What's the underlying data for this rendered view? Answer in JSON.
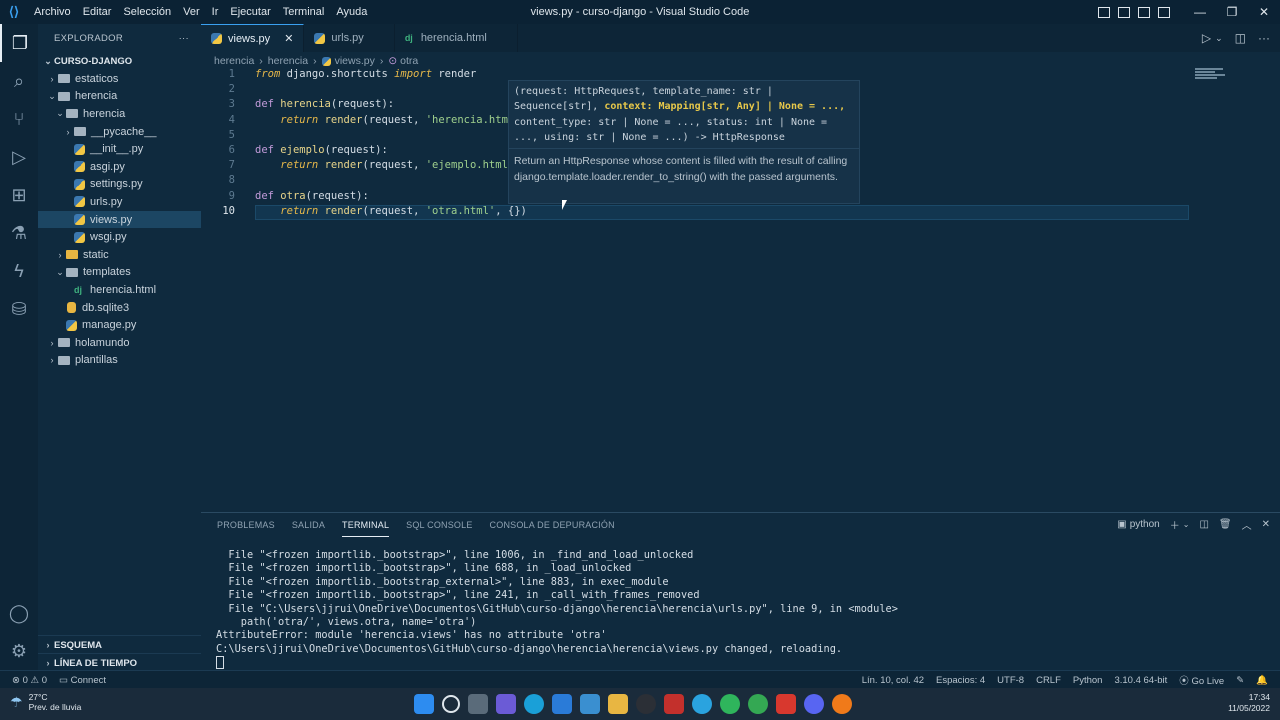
{
  "window": {
    "title": "views.py - curso-django - Visual Studio Code"
  },
  "menu": [
    "Archivo",
    "Editar",
    "Selección",
    "Ver",
    "Ir",
    "Ejecutar",
    "Terminal",
    "Ayuda"
  ],
  "sidebar": {
    "header": "EXPLORADOR",
    "root": "CURSO-DJANGO",
    "tree": [
      {
        "label": "estaticos",
        "type": "folder",
        "depth": 1,
        "expanded": false
      },
      {
        "label": "herencia",
        "type": "folder",
        "depth": 1,
        "expanded": true
      },
      {
        "label": "herencia",
        "type": "folder",
        "depth": 2,
        "expanded": true
      },
      {
        "label": "__pycache__",
        "type": "folder",
        "depth": 3,
        "expanded": false
      },
      {
        "label": "__init__.py",
        "type": "py",
        "depth": 3
      },
      {
        "label": "asgi.py",
        "type": "py",
        "depth": 3
      },
      {
        "label": "settings.py",
        "type": "py",
        "depth": 3
      },
      {
        "label": "urls.py",
        "type": "py",
        "depth": 3
      },
      {
        "label": "views.py",
        "type": "py",
        "depth": 3,
        "selected": true
      },
      {
        "label": "wsgi.py",
        "type": "py",
        "depth": 3
      },
      {
        "label": "static",
        "type": "folder-yellow",
        "depth": 2,
        "expanded": false
      },
      {
        "label": "templates",
        "type": "folder",
        "depth": 2,
        "expanded": true
      },
      {
        "label": "herencia.html",
        "type": "dj",
        "depth": 3
      },
      {
        "label": "db.sqlite3",
        "type": "db",
        "depth": 2
      },
      {
        "label": "manage.py",
        "type": "py",
        "depth": 2
      },
      {
        "label": "holamundo",
        "type": "folder",
        "depth": 1,
        "expanded": false
      },
      {
        "label": "plantillas",
        "type": "folder",
        "depth": 1,
        "expanded": false
      }
    ],
    "outline": "ESQUEMA",
    "timeline": "LÍNEA DE TIEMPO"
  },
  "tabs": [
    {
      "label": "views.py",
      "icon": "py",
      "active": true
    },
    {
      "label": "urls.py",
      "icon": "py",
      "active": false
    },
    {
      "label": "herencia.html",
      "icon": "dj",
      "active": false
    }
  ],
  "breadcrumb": [
    "herencia",
    "herencia",
    "views.py",
    "otra"
  ],
  "code": {
    "current_line": 10,
    "lines": [
      [
        {
          "t": "from",
          "c": "kwi"
        },
        {
          "t": " django.shortcuts ",
          "c": ""
        },
        {
          "t": "import",
          "c": "kwi"
        },
        {
          "t": " render",
          "c": ""
        }
      ],
      [],
      [
        {
          "t": "def",
          "c": "kw"
        },
        {
          "t": " ",
          "c": ""
        },
        {
          "t": "herencia",
          "c": "fn"
        },
        {
          "t": "(request):",
          "c": ""
        }
      ],
      [
        {
          "t": "    ",
          "c": ""
        },
        {
          "t": "return",
          "c": "kwi"
        },
        {
          "t": " ",
          "c": ""
        },
        {
          "t": "render",
          "c": "fn"
        },
        {
          "t": "(request, ",
          "c": ""
        },
        {
          "t": "'herencia.html",
          "c": "str"
        }
      ],
      [],
      [
        {
          "t": "def",
          "c": "kw"
        },
        {
          "t": " ",
          "c": ""
        },
        {
          "t": "ejemplo",
          "c": "fn"
        },
        {
          "t": "(request):",
          "c": ""
        }
      ],
      [
        {
          "t": "    ",
          "c": ""
        },
        {
          "t": "return",
          "c": "kwi"
        },
        {
          "t": " ",
          "c": ""
        },
        {
          "t": "render",
          "c": "fn"
        },
        {
          "t": "(request, ",
          "c": ""
        },
        {
          "t": "'ejemplo.html",
          "c": "str"
        }
      ],
      [],
      [
        {
          "t": "def",
          "c": "kw"
        },
        {
          "t": " ",
          "c": ""
        },
        {
          "t": "otra",
          "c": "fn"
        },
        {
          "t": "(request):",
          "c": ""
        }
      ],
      [
        {
          "t": "    ",
          "c": ""
        },
        {
          "t": "return",
          "c": "kwi"
        },
        {
          "t": " ",
          "c": ""
        },
        {
          "t": "render",
          "c": "fn"
        },
        {
          "t": "(request, ",
          "c": ""
        },
        {
          "t": "'otra.html'",
          "c": "str"
        },
        {
          "t": ", {})",
          "c": ""
        }
      ]
    ]
  },
  "hover": {
    "sig_pre": "(request: HttpRequest, template_name: str | Sequence[str], ",
    "sig_bold": "context: Mapping[str, Any] | None = ...,",
    "sig_post": " content_type: str | None = ..., status: int | None = ..., using: str | None = ...) -> HttpResponse",
    "doc": "Return an HttpResponse whose content is filled with the result of calling django.template.loader.render_to_string() with the passed arguments."
  },
  "panel": {
    "tabs": [
      "PROBLEMAS",
      "SALIDA",
      "TERMINAL",
      "SQL CONSOLE",
      "CONSOLA DE DEPURACIÓN"
    ],
    "active_tab": "TERMINAL",
    "terminal_name": "python",
    "terminal_lines": [
      "  File \"<frozen importlib._bootstrap>\", line 1006, in _find_and_load_unlocked",
      "  File \"<frozen importlib._bootstrap>\", line 688, in _load_unlocked",
      "  File \"<frozen importlib._bootstrap_external>\", line 883, in exec_module",
      "  File \"<frozen importlib._bootstrap>\", line 241, in _call_with_frames_removed",
      "  File \"C:\\Users\\jjrui\\OneDrive\\Documentos\\GitHub\\curso-django\\herencia\\herencia\\urls.py\", line 9, in <module>",
      "    path('otra/', views.otra, name='otra')",
      "AttributeError: module 'herencia.views' has no attribute 'otra'",
      "C:\\Users\\jjrui\\OneDrive\\Documentos\\GitHub\\curso-django\\herencia\\herencia\\views.py changed, reloading."
    ]
  },
  "status": {
    "errors": "0",
    "warnings": "0",
    "connect": "Connect",
    "position": "Lín. 10, col. 42",
    "spaces": "Espacios: 4",
    "encoding": "UTF-8",
    "eol": "CRLF",
    "language": "Python",
    "interpreter": "3.10.4 64-bit",
    "golive": "Go Live"
  },
  "taskbar": {
    "temp": "27°C",
    "weather": "Prev. de lluvia",
    "time": "17:34",
    "date": "11/05/2022"
  },
  "colors": {
    "accent": "#3aa0f0",
    "bg": "#0f2a3e",
    "string": "#9fd08d",
    "function": "#e7d48a",
    "keyword": "#c19bd9"
  }
}
